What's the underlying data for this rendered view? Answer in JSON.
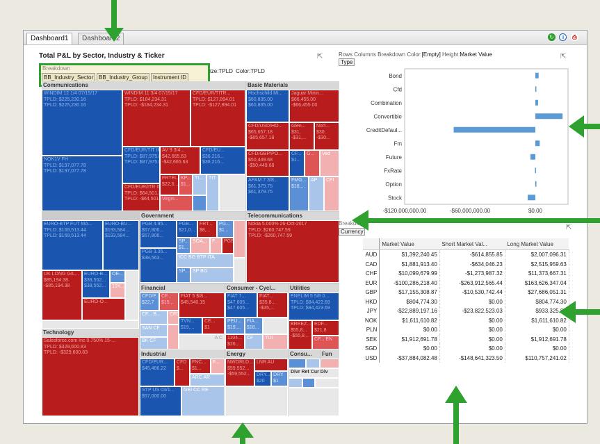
{
  "tabs": [
    "Dashboard1",
    "Dashboard2"
  ],
  "title": "Total P&L by Sector, Industry & Ticker",
  "breakdown": {
    "label": "Breakdown",
    "items": [
      "BB_Industry_Sector",
      "BB_Industry_Group",
      "Instrument ID"
    ],
    "suffix_size": "ize:",
    "size_val": "TPLD",
    "suffix_color": "Color:",
    "color_val": "TPLD"
  },
  "sectors": {
    "communications": "Communications",
    "basic": "Basic Materials",
    "government": "Government",
    "telecom": "Telecommunications",
    "technology": "Technology",
    "financial": "Financial",
    "consumer_cyc": "Consumer - Cycl...",
    "utilities": "Utilities",
    "industrial": "Industrial",
    "energy": "Energy",
    "consu": "Consu...",
    "fun": "Fun"
  },
  "tiles": {
    "windim1": {
      "name": "WINDIM 12 1/4 07/15/17",
      "l1": "TPLD: $225,230.16",
      "l2": "TPLD: $225,230.16"
    },
    "windim2": {
      "name": "WINDIM 11 3/4 07/15/17",
      "l1": "TPLD: $184,234.31",
      "l2": "TPLD: -$184,234.31"
    },
    "cfdtitr": {
      "name": "CFD/EUR/TITR...",
      "l1": "TPLD: $127,894.01",
      "l2": "TPLD: -$127,894.01"
    },
    "nok": {
      "name": "NOK1V FH",
      "l1": "TPLD: $197,077.78",
      "l2": "TPLD: $197,077.78"
    },
    "cfdtit": {
      "name": "CFD/EUR/TIT IM",
      "l1": "TPLD: $87,975.85",
      "l2": "TPLD: $87,975.85"
    },
    "av9": {
      "name": "AV 9 3/4...",
      "l1": "$42,665.63",
      "l2": "-$42,665.63"
    },
    "cfdeu": {
      "name": "CFD/EU...",
      "l1": "$36,216...",
      "l2": "$36,216..."
    },
    "frtel": {
      "name": "FRTEL...",
      "l1": "$22,6..."
    },
    "kp": {
      "name": "KP...",
      "l1": "$1..."
    },
    "ti": {
      "name": "TI..."
    },
    "tit": {
      "name": "TIT"
    },
    "cfditr": {
      "name": "CFD/EUR/ITR IM",
      "l1": "TPLD: $64,501.38",
      "l2": "TPLD: -$64,501.38"
    },
    "virgin": {
      "name": "Virgin..."
    },
    "hoch": {
      "name": "Hochschild Mi...",
      "l1": "$60,835.00",
      "l2": "$60,835.00"
    },
    "jaguar": {
      "name": "Jaguar Minin...",
      "l1": "$66,455.00",
      "l2": "-$66,455.00"
    },
    "cfdusd": {
      "name": "CFD/USD/HO...",
      "l1": "$65,657.18",
      "l2": "-$65,657.18"
    },
    "glen": {
      "name": "Glen...",
      "l1": "$31,",
      "l2": "-$31,..."
    },
    "nort": {
      "name": "Nort...",
      "l1": "$30,",
      "l2": "-$30..."
    },
    "cfdgbp": {
      "name": "CFD/GBP/PO...",
      "l1": "$50,449.68",
      "l2": "-$50,449.68"
    },
    "cf": {
      "name": "CF...",
      "l1": "$1..."
    },
    "g": {
      "name": "G..."
    },
    "ved": {
      "name": "Ved"
    },
    "apam": {
      "name": "APAM 7 3/8...",
      "l1": "$61,379.75",
      "l2": "$61,379.75"
    },
    "fmg": {
      "name": "FMG...",
      "l1": "$18,..."
    },
    "ap": {
      "name": "AP"
    },
    "cfi": {
      "name": "CFI"
    },
    "nokia": {
      "name": "Nokia 5.000% 26-Oct-2017",
      "l1": "TPLD: $260,747.59",
      "l2": "TPLD: -$260,747.59"
    },
    "btp": {
      "name": "EURO-BTP FUT MA...",
      "l1": "TPLD: $169,513.44",
      "l2": "TPLD: $169,513.44"
    },
    "eurobu": {
      "name": "EURO-BU...",
      "l1": "$193,584...",
      "l2": "$193,584..."
    },
    "ukgil": {
      "name": "UK LONG GIL...",
      "l1": "$85,194.38",
      "l2": "-$85,194.38"
    },
    "eurob2": {
      "name": "EURO-B...",
      "l1": "$38,552...",
      "l2": "$38,552..."
    },
    "oe": {
      "name": "OE..."
    },
    "y10": {
      "name": "10Y..."
    },
    "euroo": {
      "name": "EURO-O..."
    },
    "pgb495": {
      "name": "PGB 4.95...",
      "l1": "$57,806...",
      "l2": "$57,806..."
    },
    "pgb2": {
      "name": "PGB...",
      "l1": "$21,0..."
    },
    "frt": {
      "name": "FRT...",
      "l1": "$8,..."
    },
    "pg": {
      "name": "PG...",
      "l1": "$1..."
    },
    "sp1": {
      "name": "SP...",
      "l1": "$1..."
    },
    "soa": {
      "name": "SOA..."
    },
    "f": {
      "name": "F..."
    },
    "pgbx": {
      "name": "PGE"
    },
    "pgb335": {
      "name": "PGB 3.35...",
      "l1": "$38,563..."
    },
    "icc": {
      "name": "ICC BG BTP ITA"
    },
    "sp2": {
      "name": "SP..."
    },
    "sp3": {
      "name": "SP BG"
    },
    "sfdc": {
      "name": "Salesforce.com Inc 0.750% 15-...",
      "l1": "TPLD: $329,600.83",
      "l2": "TPLD: -$329,600.83"
    },
    "cfde": {
      "name": "CFD/E...",
      "l1": "$22,7"
    },
    "cf2": {
      "name": "CF...",
      "l1": "$15..."
    },
    "fiat5": {
      "name": "FIAT 5 $/8...",
      "l1": "$45,540.15"
    },
    "cfb": {
      "name": "CF... B..."
    },
    "cfd3": {
      "name": "CFD"
    },
    "tvn": {
      "name": "TVN...",
      "l1": "$19,..."
    },
    "ce": {
      "name": "CE...",
      "l1": "$1"
    },
    "san": {
      "name": "SAN CF"
    },
    "bk": {
      "name": "BK CF"
    },
    "ac": {
      "name": "A C"
    },
    "fiat7": {
      "name": "FIAT 7...",
      "l1": "$47,605...",
      "l2": "$47,605..."
    },
    "fiat2": {
      "name": "FIAT...",
      "l1": "$35,8...",
      "l2": "-$35,..."
    },
    "peu": {
      "name": "PEU...",
      "l1": "$19,..."
    },
    "fia": {
      "name": "FIA...",
      "l1": "$18..."
    },
    "c1104": {
      "name": "1104...",
      "l1": "$26,..."
    },
    "cf3": {
      "name": "CF"
    },
    "tui": {
      "name": "TUI"
    },
    "enelim": {
      "name": "ENELIM 5 5/8 0...",
      "l1": "TPLD: $84,423.69",
      "l2": "TPLD: $84,423.69"
    },
    "breez": {
      "name": "BREEZ...",
      "l1": "$55,8...",
      "l2": "-$55,8..."
    },
    "edf": {
      "name": "EDF...",
      "l1": "$21,8"
    },
    "cf4": {
      "name": "CF... EN"
    },
    "cfdeur": {
      "name": "CFD/EUR...",
      "l1": "$45,486.22"
    },
    "cfd5": {
      "name": "CFD",
      "l1": "$..."
    },
    "fnc": {
      "name": "FNC...",
      "l1": "$1..."
    },
    "f2": {
      "name": "F..."
    },
    "stp": {
      "name": "STP US 03/1...",
      "l1": "$57,000.00"
    },
    "arc": {
      "name": "ARC AR"
    },
    "gei": {
      "name": "GEI CC RE"
    },
    "nworld": {
      "name": "NWORLD...",
      "l1": "$59,552...",
      "l2": "-$59,552..."
    },
    "lnr": {
      "name": "LNR AU"
    },
    "dry": {
      "name": "DRY...",
      "l1": "$20"
    },
    "dry2": {
      "name": "DRY",
      "l1": "$1"
    },
    "divrel": {
      "name": "Divr Ret Cur Div"
    }
  },
  "bar_chart": {
    "header": {
      "rows": "Rows",
      "columns": "Columns",
      "breakdown": "Breakdown",
      "color": "Color:",
      "color_val": "[Empty]",
      "height": "Height:",
      "height_val": "Market Value",
      "type_btn": "Type"
    },
    "categories": [
      "Bond",
      "Cfd",
      "Combination",
      "Convertible",
      "CreditDefaul...",
      "Fm",
      "Future",
      "FxRate",
      "Option",
      "Stock"
    ],
    "values": [
      3000000,
      500000,
      2500000,
      25000000,
      -75000000,
      4000000,
      -4500000,
      -300000,
      1000000,
      -7000000
    ],
    "x_ticks": [
      "-$120,000,000.00",
      "-$60,000,000.00",
      "$0.00"
    ],
    "xlabel": "Market Value"
  },
  "chart_data": {
    "type": "bar",
    "orientation": "horizontal",
    "categories": [
      "Bond",
      "Cfd",
      "Combination",
      "Convertible",
      "CreditDefaul...",
      "Fm",
      "Future",
      "FxRate",
      "Option",
      "Stock"
    ],
    "values": [
      3000000,
      500000,
      2500000,
      25000000,
      -75000000,
      4000000,
      -4500000,
      -300000,
      1000000,
      -7000000
    ],
    "xlabel": "Market Value",
    "xlim": [
      -120000000,
      30000000
    ],
    "x_ticks": [
      "-$120,000,000.00",
      "-$60,000,000.00",
      "$0.00"
    ]
  },
  "currency_table": {
    "breakdown_label": "Breakdown",
    "btn": "Currency",
    "headers": [
      "Market Value",
      "Short Market Val...",
      "Long Market Value"
    ],
    "rows": [
      [
        "AUD",
        "$1,392,240.45",
        "-$614,855.85",
        "$2,007,096.31"
      ],
      [
        "CAD",
        "$1,881,913.40",
        "-$634,046.23",
        "$2,515,959.63"
      ],
      [
        "CHF",
        "$10,099,679.99",
        "-$1,273,987.32",
        "$11,373,667.31"
      ],
      [
        "EUR",
        "-$100,286,218.40",
        "-$263,912,565.44",
        "$163,626,347.04"
      ],
      [
        "GBP",
        "$17,155,308.87",
        "-$10,530,742.44",
        "$27,686,051.31"
      ],
      [
        "HKD",
        "$804,774.30",
        "$0.00",
        "$804,774.30"
      ],
      [
        "JPY",
        "-$22,889,197.16",
        "-$23,822,523.03",
        "$933,325.87"
      ],
      [
        "NOK",
        "$1,611,610.82",
        "$0.00",
        "$1,611,610.82"
      ],
      [
        "PLN",
        "$0.00",
        "$0.00",
        "$0.00"
      ],
      [
        "SEK",
        "$1,912,691.78",
        "$0.00",
        "$1,912,691.78"
      ],
      [
        "SGD",
        "$0.00",
        "$0.00",
        "$0.00"
      ],
      [
        "USD",
        "-$37,884,082.48",
        "-$148,641,323.50",
        "$110,757,241.02"
      ]
    ]
  },
  "colors": {
    "accent_green": "#2ea12e",
    "dark_blue": "#1a56b0",
    "dark_red": "#b81c1c",
    "bar_blue": "#5b9bd5"
  }
}
